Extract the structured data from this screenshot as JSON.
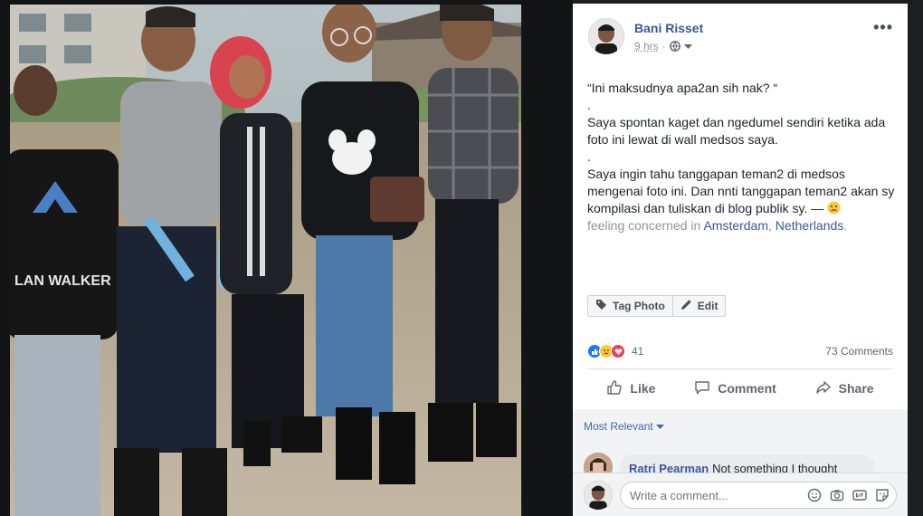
{
  "post": {
    "author": "Bani Risset",
    "time": "9 hrs",
    "privacy_separator": "·",
    "more_label": "•••",
    "text_lines": [
      "“Ini maksudnya apa2an sih nak? “",
      ".",
      "Saya spontan kaget dan ngedumel sendiri ketika ada foto ini lewat di wall medsos saya.",
      ".",
      "Saya ingin tahu tanggapan teman2 di medsos mengenai foto ini. Dan nnti tanggapan teman2 akan sy kompilasi dan tuliskan di blog publik sy. —"
    ],
    "feeling_prefix": "feeling concerned in",
    "location_city": "Amsterdam",
    "location_separator": ", ",
    "location_country": "Netherlands",
    "location_end": "."
  },
  "photo_actions": {
    "tag_photo": "Tag Photo",
    "edit": "Edit"
  },
  "stats": {
    "reaction_count": "41",
    "comments_count": "73 Comments"
  },
  "action_bar": {
    "like": "Like",
    "comment": "Comment",
    "share": "Share"
  },
  "comments": {
    "sort_label": "Most Relevant",
    "items": [
      {
        "author": "Ratri Pearman",
        "text": "Not something I thought"
      }
    ]
  },
  "composer": {
    "placeholder": "Write a comment..."
  },
  "colors": {
    "link": "#385898",
    "like_blue": "#1877f2",
    "love_red": "#f33e58",
    "sad_yellow": "#fcc83a"
  },
  "icons": [
    "globe-icon",
    "chevron-down-icon",
    "tag-icon",
    "pencil-icon",
    "like-icon",
    "comment-icon",
    "share-icon",
    "emoji-icon",
    "camera-icon",
    "gif-icon",
    "sticker-icon"
  ]
}
